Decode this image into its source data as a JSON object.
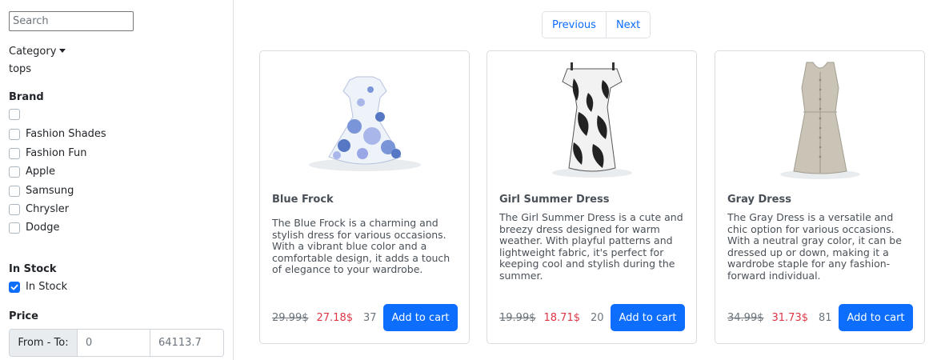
{
  "sidebar": {
    "search_placeholder": "Search",
    "category_label": "Category",
    "category_value": "tops",
    "brand_title": "Brand",
    "brands": [
      {
        "label": "",
        "checked": false
      },
      {
        "label": "Fashion Shades",
        "checked": false
      },
      {
        "label": "Fashion Fun",
        "checked": false
      },
      {
        "label": "Apple",
        "checked": false
      },
      {
        "label": "Samsung",
        "checked": false
      },
      {
        "label": "Chrysler",
        "checked": false
      },
      {
        "label": "Dodge",
        "checked": false
      }
    ],
    "stock_title": "In Stock",
    "stock_option": {
      "label": "In Stock",
      "checked": true
    },
    "price_title": "Price",
    "price_range_label": "From - To:",
    "price_from": "0",
    "price_to": "64113.7"
  },
  "pagination": {
    "previous": "Previous",
    "next": "Next"
  },
  "products": [
    {
      "title": "Blue Frock",
      "description": "The Blue Frock is a charming and stylish dress for various occasions. With a vibrant blue color and a comfortable design, it adds a touch of elegance to your wardrobe.",
      "old_price": "29.99$",
      "price": "27.18$",
      "stock": "37",
      "button": "Add to cart",
      "image": "blue-polka-dot-dress"
    },
    {
      "title": "Girl Summer Dress",
      "description": "The Girl Summer Dress is a cute and breezy dress designed for warm weather. With playful patterns and lightweight fabric, it's perfect for keeping cool and stylish during the summer.",
      "old_price": "19.99$",
      "price": "18.71$",
      "stock": "20",
      "button": "Add to cart",
      "image": "black-white-leaf-print-dress"
    },
    {
      "title": "Gray Dress",
      "description": "The Gray Dress is a versatile and chic option for various occasions. With a neutral gray color, it can be dressed up or down, making it a wardrobe staple for any fashion-forward individual.",
      "old_price": "34.99$",
      "price": "31.73$",
      "stock": "81",
      "button": "Add to cart",
      "image": "gray-sleeveless-dress"
    }
  ],
  "colors": {
    "accent": "#0d6efd",
    "sale": "#dc3545",
    "muted": "#6c757d"
  }
}
